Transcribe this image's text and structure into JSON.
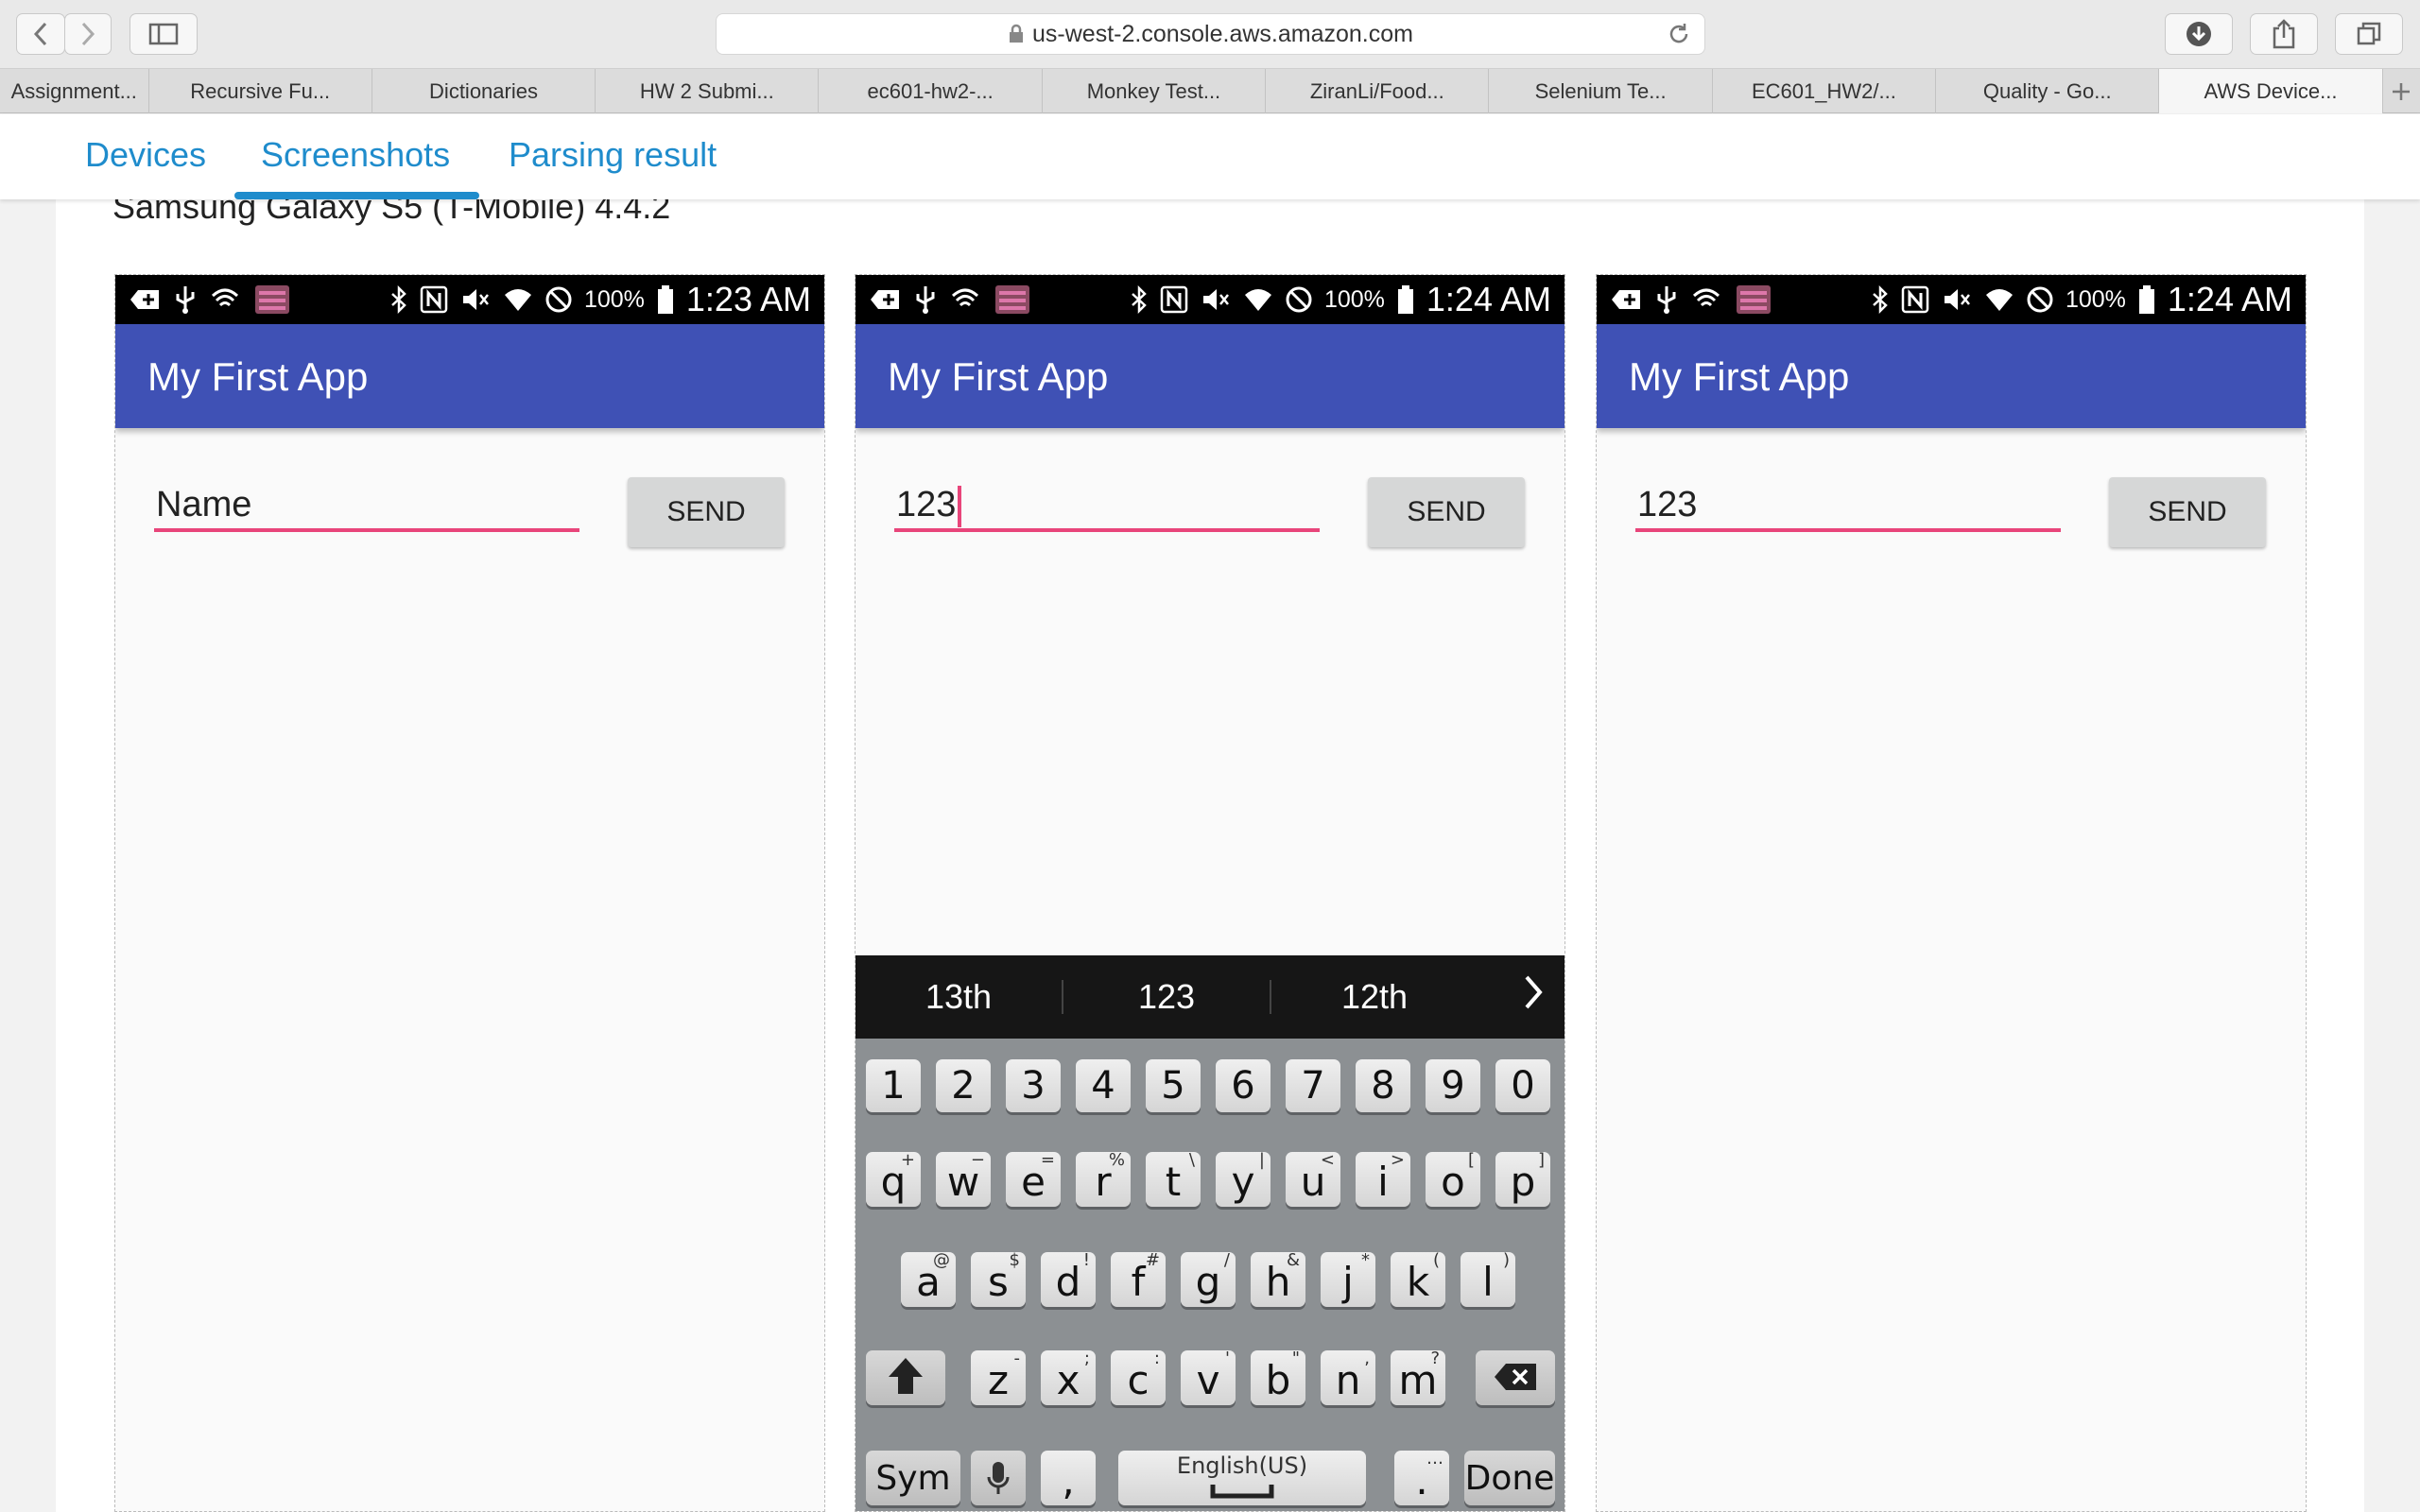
{
  "browser": {
    "url": "us-west-2.console.aws.amazon.com",
    "tabs": [
      "Assignment...",
      "Recursive Fu...",
      "Dictionaries",
      "HW 2 Submi...",
      "ec601-hw2-...",
      "Monkey Test...",
      "ZiranLi/Food...",
      "Selenium Te...",
      "EC601_HW2/...",
      "Quality - Go...",
      "AWS Device..."
    ],
    "active_tab": 10
  },
  "nav": {
    "devices": "Devices",
    "screenshots": "Screenshots",
    "parsing": "Parsing result"
  },
  "device_title": "Samsung Galaxy S5 (T-Mobile) 4.4.2",
  "phones": [
    {
      "time": "1:23 AM",
      "battery": "100%",
      "app_title": "My First App",
      "field_text": "Name",
      "send": "SEND"
    },
    {
      "time": "1:24 AM",
      "battery": "100%",
      "app_title": "My First App",
      "field_text": "123",
      "send": "SEND"
    },
    {
      "time": "1:24 AM",
      "battery": "100%",
      "app_title": "My First App",
      "field_text": "123",
      "send": "SEND"
    }
  ],
  "keyboard": {
    "suggestions": [
      "13th",
      "123",
      "12th"
    ],
    "numbers": [
      "1",
      "2",
      "3",
      "4",
      "5",
      "6",
      "7",
      "8",
      "9",
      "0"
    ],
    "row1": [
      [
        "q",
        "+"
      ],
      [
        "w",
        "−"
      ],
      [
        "e",
        "="
      ],
      [
        "r",
        "%"
      ],
      [
        "t",
        "\\"
      ],
      [
        "y",
        "|"
      ],
      [
        "u",
        "<"
      ],
      [
        "i",
        ">"
      ],
      [
        "o",
        "["
      ],
      [
        "p",
        "]"
      ]
    ],
    "row2": [
      [
        "a",
        "@"
      ],
      [
        "s",
        "$"
      ],
      [
        "d",
        "!"
      ],
      [
        "f",
        "#"
      ],
      [
        "g",
        "/"
      ],
      [
        "h",
        "&"
      ],
      [
        "j",
        "*"
      ],
      [
        "k",
        "("
      ],
      [
        "l",
        ")"
      ]
    ],
    "row3": [
      [
        "z",
        "-"
      ],
      [
        "x",
        ";"
      ],
      [
        "c",
        ":"
      ],
      [
        "v",
        "'"
      ],
      [
        "b",
        "\""
      ],
      [
        "n",
        ","
      ],
      [
        "m",
        "?"
      ]
    ],
    "sym": "Sym",
    "comma": ",",
    "space_label": "English(US)",
    "period": ".",
    "done": "Done"
  }
}
